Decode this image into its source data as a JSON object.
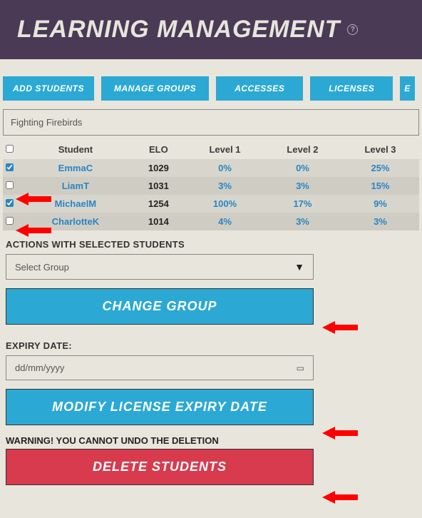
{
  "header": {
    "title": "LEARNING MANAGEMENT"
  },
  "tabs": {
    "add": "ADD STUDENTS",
    "manage": "MANAGE GROUPS",
    "accesses": "ACCESSES",
    "licenses": "LICENSES",
    "extra": "E"
  },
  "group_name": "Fighting Firebirds",
  "columns": {
    "student": "Student",
    "elo": "ELO",
    "l1": "Level 1",
    "l2": "Level 2",
    "l3": "Level 3"
  },
  "students": [
    {
      "checked": true,
      "name": "EmmaC",
      "elo": "1029",
      "l1": "0%",
      "l2": "0%",
      "l3": "25%"
    },
    {
      "checked": false,
      "name": "LiamT",
      "elo": "1031",
      "l1": "3%",
      "l2": "3%",
      "l3": "15%"
    },
    {
      "checked": true,
      "name": "MichaelM",
      "elo": "1254",
      "l1": "100%",
      "l2": "17%",
      "l3": "9%"
    },
    {
      "checked": false,
      "name": "CharlotteK",
      "elo": "1014",
      "l1": "4%",
      "l2": "3%",
      "l3": "3%"
    }
  ],
  "actions": {
    "heading": "ACTIONS WITH SELECTED STUDENTS",
    "select_placeholder": "Select Group",
    "change_group": "CHANGE GROUP",
    "expiry_label": "EXPIRY DATE:",
    "date_placeholder": "dd/mm/yyyy",
    "modify_expiry": "MODIFY LICENSE EXPIRY DATE",
    "warning": "WARNING! YOU CANNOT UNDO THE DELETION",
    "delete": "DELETE STUDENTS"
  }
}
